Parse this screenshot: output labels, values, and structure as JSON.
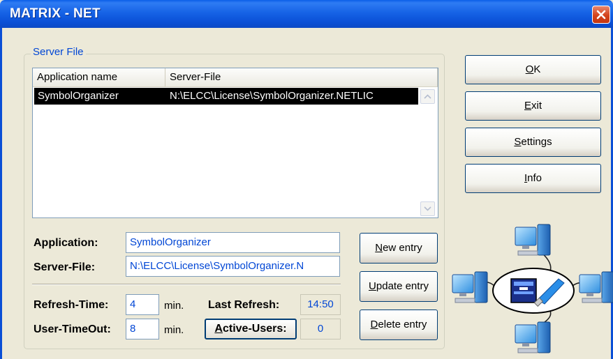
{
  "window": {
    "title": "MATRIX - NET"
  },
  "group": {
    "legend": "Server File"
  },
  "list": {
    "columns": [
      "Application name",
      "Server-File"
    ],
    "rows": [
      {
        "app": "SymbolOrganizer",
        "file": "N:\\ELCC\\License\\SymbolOrganizer.NETLIC"
      }
    ]
  },
  "form": {
    "application_label": "Application:",
    "application_value": "SymbolOrganizer",
    "serverfile_label": "Server-File:",
    "serverfile_value": "N:\\ELCC\\License\\SymbolOrganizer.N",
    "refresh_label": "Refresh-Time:",
    "refresh_value": "4",
    "refresh_unit": "min.",
    "timeout_label": "User-TimeOut:",
    "timeout_value": "8",
    "timeout_unit": "min.",
    "last_refresh_label": "Last Refresh:",
    "last_refresh_value": "14:50",
    "active_users_first": "A",
    "active_users_rest": "ctive-Users:",
    "active_users_value": "0"
  },
  "entry_buttons": {
    "new": {
      "mnemonic": "N",
      "rest": "ew entry"
    },
    "update": {
      "mnemonic": "U",
      "rest": "pdate entry"
    },
    "delete": {
      "mnemonic": "D",
      "rest": "elete entry"
    }
  },
  "side_buttons": {
    "ok": {
      "mnemonic": "O",
      "rest": "K"
    },
    "exit": {
      "mnemonic": "E",
      "rest": "xit"
    },
    "settings": {
      "mnemonic": "S",
      "rest": "ettings"
    },
    "info": {
      "mnemonic": "I",
      "rest": "nfo"
    }
  },
  "colors": {
    "titlebar": "#0a5ee8",
    "selection": "#000000",
    "field_text": "#0046d5"
  },
  "icons": {
    "close": "close-icon",
    "network": "network-diagram-icon",
    "computer": "computer-icon",
    "usb_dongle": "usb-dongle-icon"
  }
}
